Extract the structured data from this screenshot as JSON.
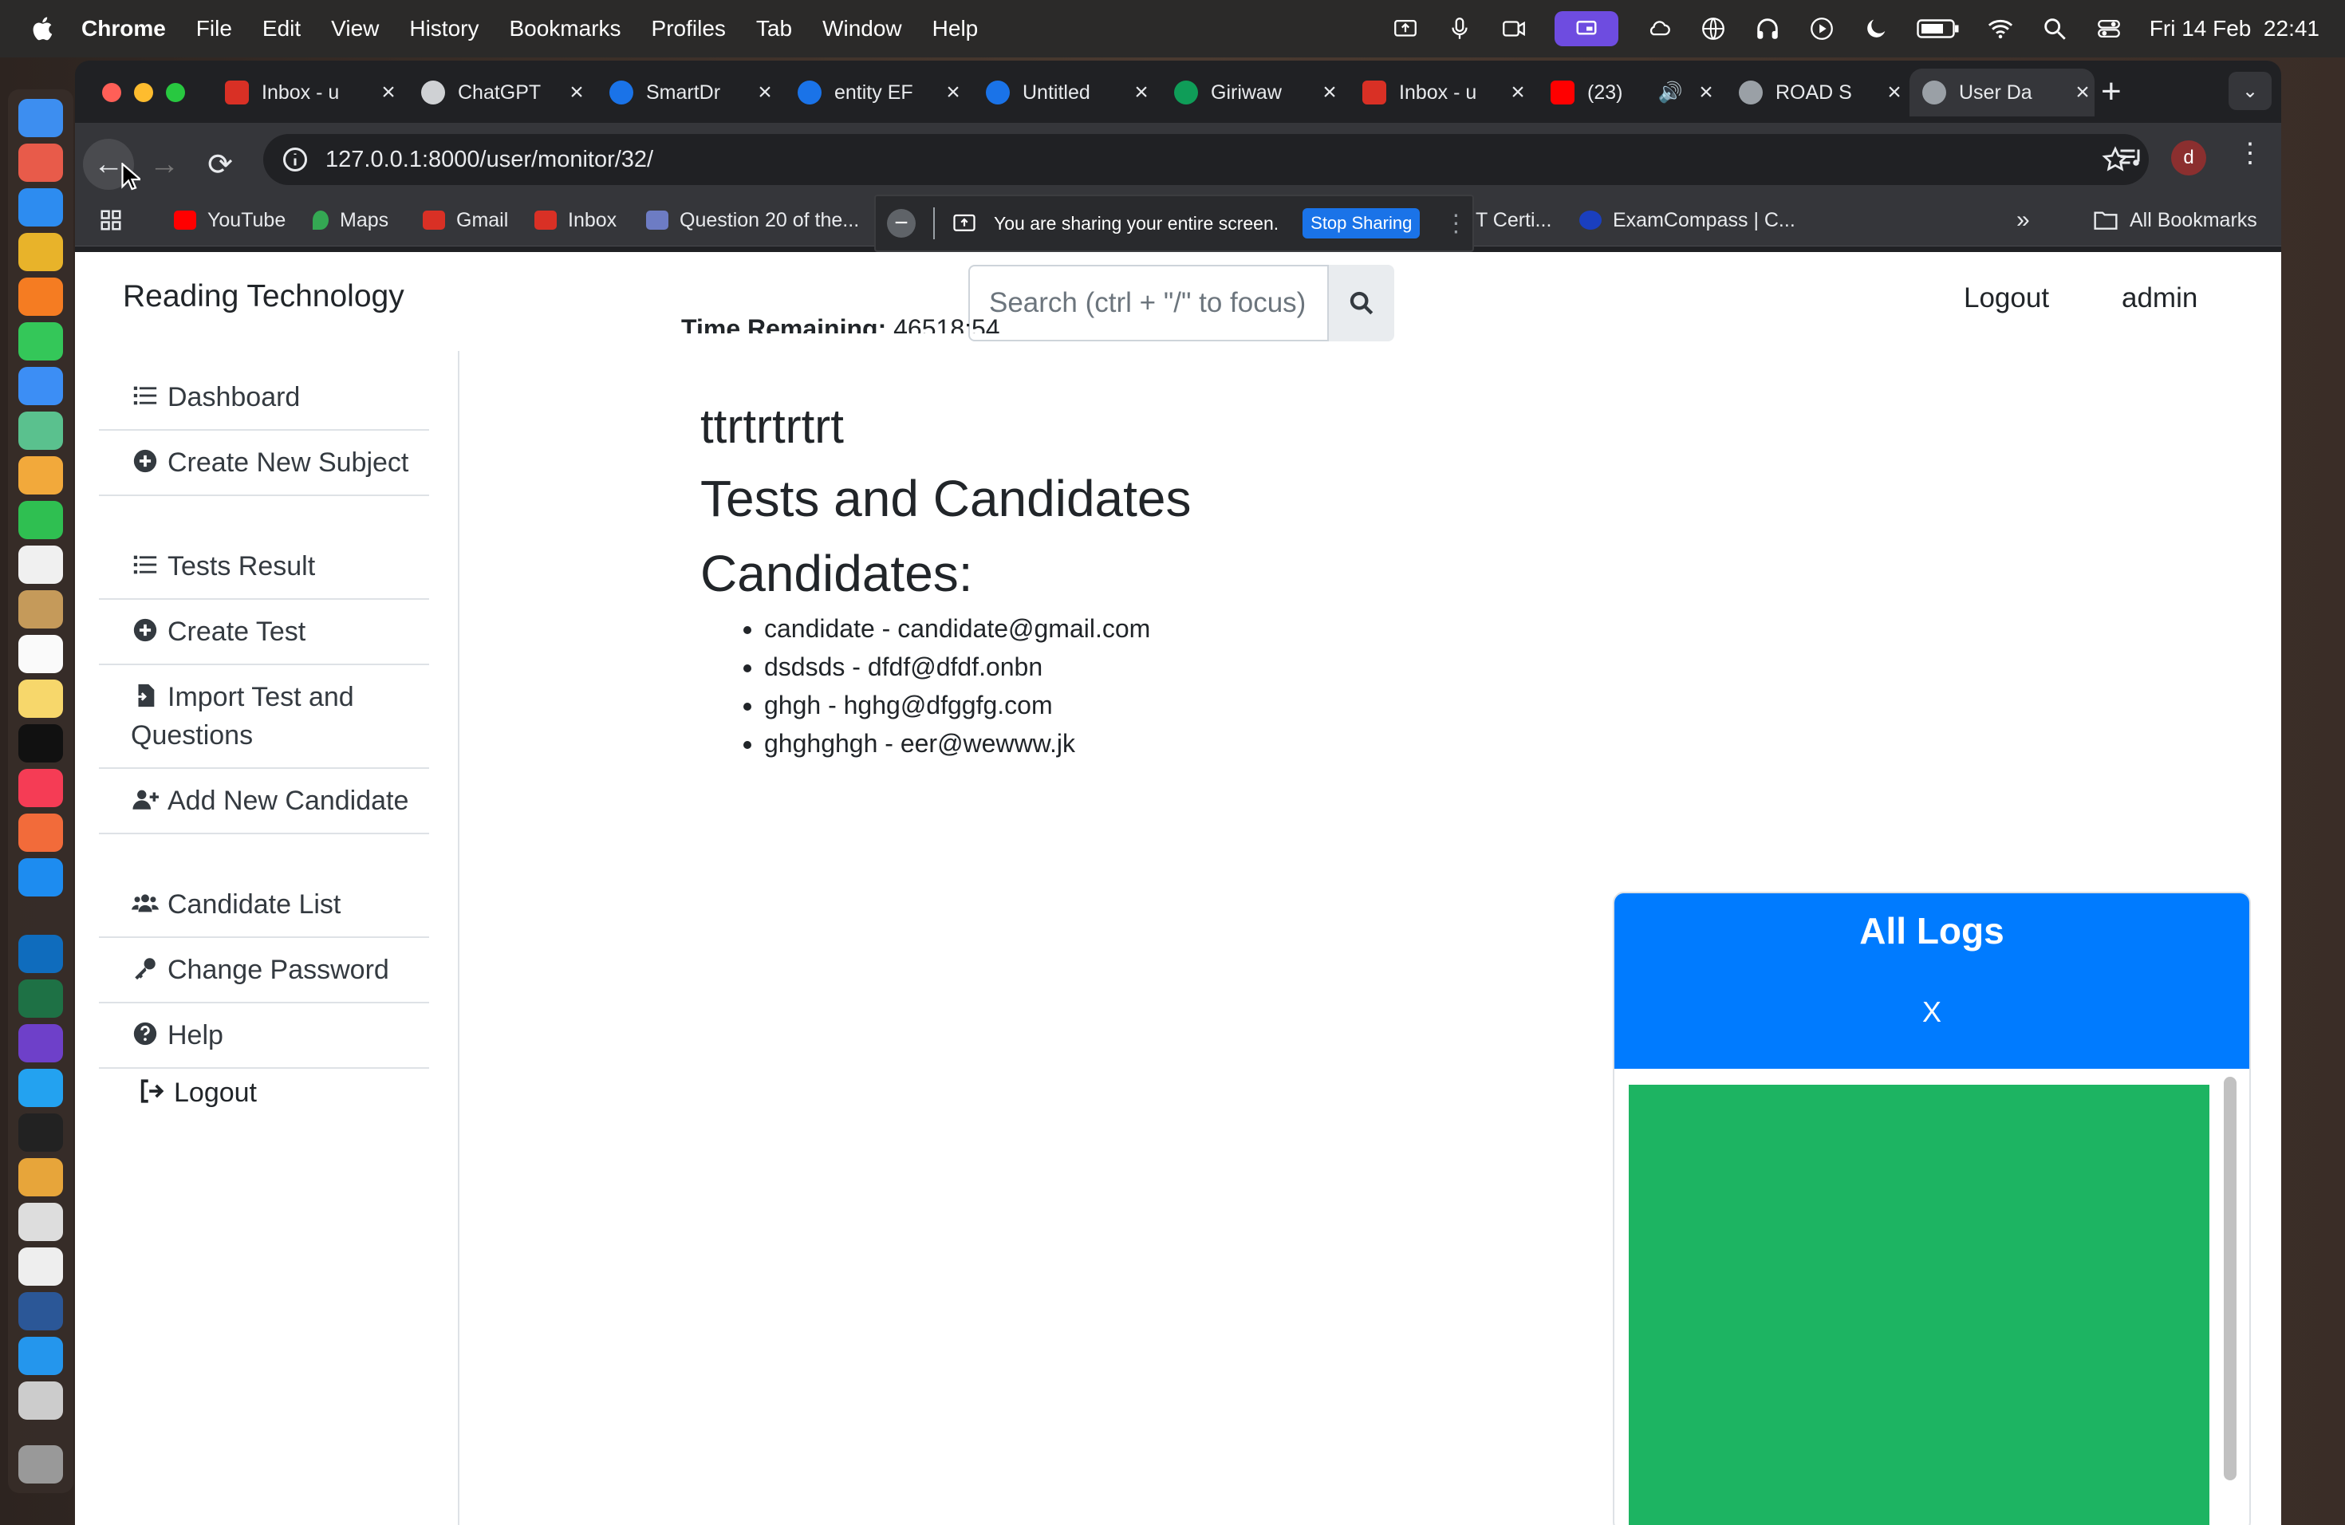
{
  "menubar": {
    "app": "Chrome",
    "items": [
      "File",
      "Edit",
      "View",
      "History",
      "Bookmarks",
      "Profiles",
      "Tab",
      "Window",
      "Help"
    ],
    "clock": "Fri 14 Feb  22:41"
  },
  "tabs": [
    {
      "title": "Inbox - u",
      "color": "#d93025"
    },
    {
      "title": "ChatGPT",
      "color": "#e8eaed"
    },
    {
      "title": "SmartDr",
      "color": "#1a73e8"
    },
    {
      "title": "entity EF",
      "color": "#1a73e8"
    },
    {
      "title": "Untitled",
      "color": "#1a73e8"
    },
    {
      "title": "Giriwaw",
      "color": "#0f9d58"
    },
    {
      "title": "Inbox - u",
      "color": "#d93025"
    },
    {
      "title": "(23)",
      "color": "#ff0000"
    },
    {
      "title": "ROAD S",
      "color": "#9aa0a6"
    },
    {
      "title": "User Da",
      "color": "#9aa0a6"
    }
  ],
  "address": {
    "url": "127.0.0.1:8000/user/monitor/32/"
  },
  "profile_initial": "d",
  "bookmarks": {
    "items": [
      "YouTube",
      "Maps",
      "Gmail",
      "Inbox",
      "Question 20 of the..."
    ],
    "right_items": [
      "T Certi...",
      "ExamCompass | C..."
    ],
    "all": "All Bookmarks"
  },
  "sharing": {
    "message": "You are sharing your entire screen.",
    "stop": "Stop Sharing"
  },
  "site": {
    "brand": "Reading Technology",
    "search_placeholder": "Search (ctrl + \"/\" to focus)",
    "logout": "Logout",
    "user": "admin"
  },
  "sidebar": {
    "items": [
      {
        "label": "Dashboard",
        "icon": "list-icon"
      },
      {
        "label": "Create New Subject",
        "icon": "plus-circle-icon"
      },
      {
        "label": "Tests Result",
        "icon": "list-icon"
      },
      {
        "label": "Create Test",
        "icon": "plus-circle-icon"
      },
      {
        "label": "Import Test and Questions",
        "icon": "file-import-icon"
      },
      {
        "label": "Add New Candidate",
        "icon": "user-plus-icon"
      },
      {
        "label": "Candidate List",
        "icon": "users-icon"
      },
      {
        "label": "Change Password",
        "icon": "key-icon"
      },
      {
        "label": "Help",
        "icon": "question-circle-icon"
      },
      {
        "label": "Logout",
        "icon": "sign-out-icon"
      }
    ]
  },
  "main": {
    "time_label": "Time Remaining:",
    "time_value": "46518:54",
    "test_name": "ttrtrtrtrt",
    "section_title": "Tests and Candidates",
    "candidates_title": "Candidates:",
    "candidates": [
      "candidate - candidate@gmail.com",
      "dsdsds - dfdf@dfdf.onbn",
      "ghgh - hghg@dfggfg.com",
      "ghghghgh - eer@wewww.jk"
    ]
  },
  "logs": {
    "title": "All Logs",
    "close": "X",
    "accent": "#007bff",
    "panel_color": "#1db462"
  }
}
